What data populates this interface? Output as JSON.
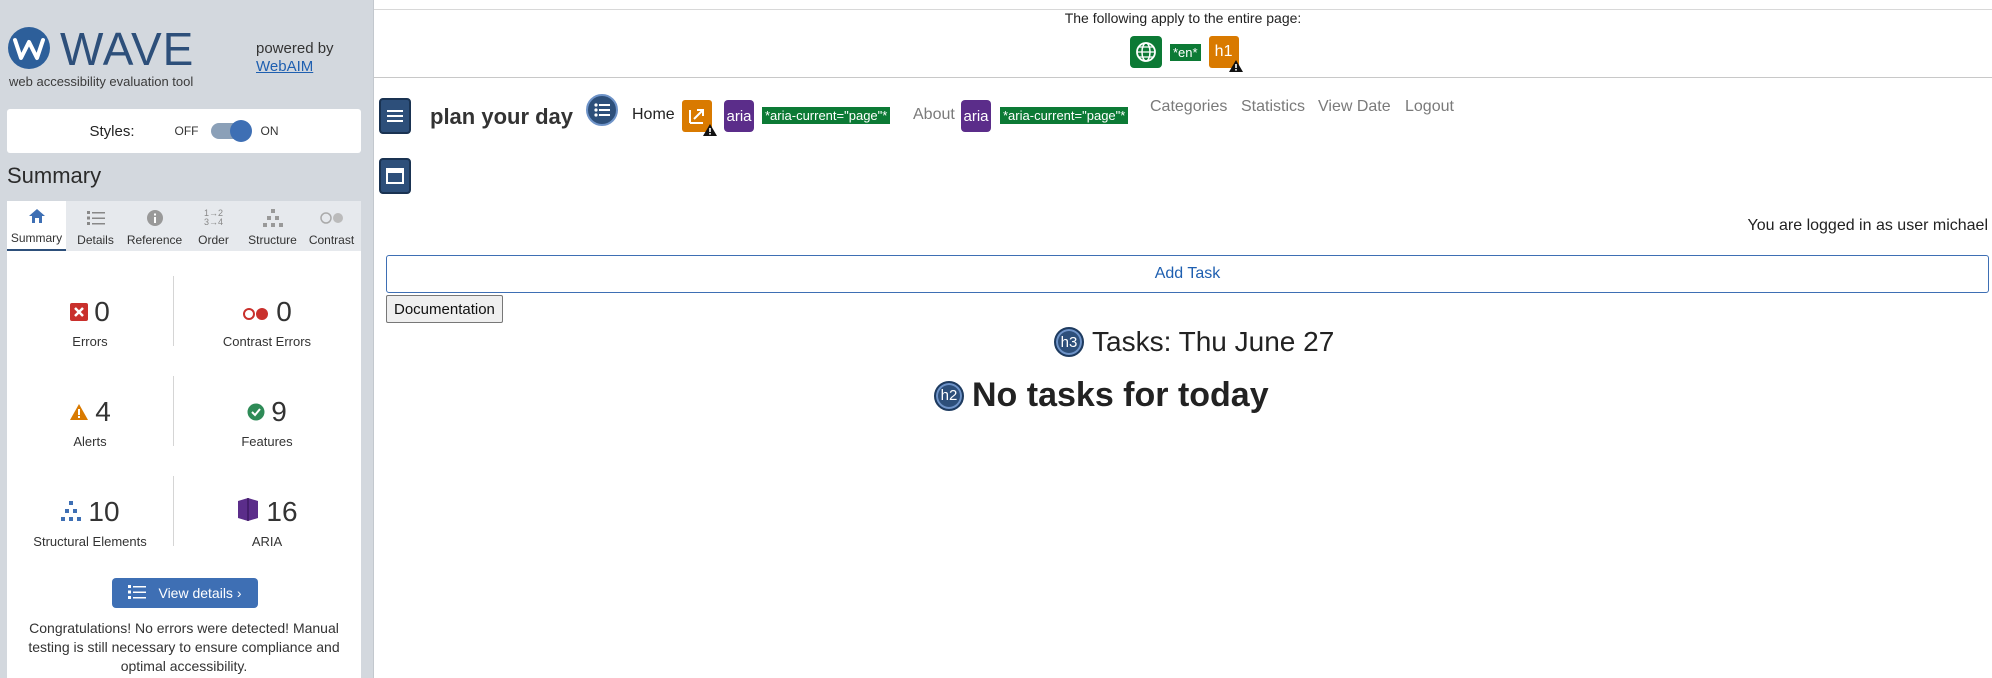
{
  "wave": {
    "logo_text": "WAVE",
    "tagline": "web accessibility evaluation tool",
    "powered_by": "powered by",
    "webaim": "WebAIM",
    "styles_label": "Styles:",
    "off": "OFF",
    "on": "ON",
    "summary_title": "Summary",
    "tabs": [
      {
        "label": "Summary",
        "icon": "home-icon"
      },
      {
        "label": "Details",
        "icon": "list-icon"
      },
      {
        "label": "Reference",
        "icon": "info-icon"
      },
      {
        "label": "Order",
        "icon": "order-icon"
      },
      {
        "label": "Structure",
        "icon": "structure-icon"
      },
      {
        "label": "Contrast",
        "icon": "contrast-icon"
      }
    ],
    "stats": {
      "errors": {
        "value": "0",
        "label": "Errors"
      },
      "contrast_errors": {
        "value": "0",
        "label": "Contrast Errors"
      },
      "alerts": {
        "value": "4",
        "label": "Alerts"
      },
      "features": {
        "value": "9",
        "label": "Features"
      },
      "structural": {
        "value": "10",
        "label": "Structural Elements"
      },
      "aria": {
        "value": "16",
        "label": "ARIA"
      }
    },
    "view_details": "View details ›",
    "congrats": "Congratulations! No errors were detected! Manual testing is still necessary to ensure compliance and optimal accessibility."
  },
  "page": {
    "apply_text": "The following apply to the entire page:",
    "lang_label": "*en*",
    "h1_label": "h1",
    "brand": "plan your day",
    "nav": {
      "home": "Home",
      "aria": "aria",
      "aria_current_1": "*aria-current=\"page\"*",
      "about": "About",
      "aria_current_2": "*aria-current=\"page\"*",
      "categories": "Categories",
      "statistics": "Statistics",
      "view_date": "View Date",
      "logout": "Logout"
    },
    "logged_in": "You are logged in as user michael",
    "add_task": "Add Task",
    "documentation": "Documentation",
    "h3_badge": "h3",
    "tasks_heading": "Tasks: Thu June 27",
    "h2_badge": "h2",
    "no_tasks": "No tasks for today"
  },
  "colors": {
    "wave_blue": "#3e6fb4",
    "wave_dark": "#2d4f7a",
    "sidebar_bg": "#d3d8de",
    "aria_purple": "#5b2d8a",
    "aria_green": "#0c7a35",
    "alert_orange": "#d97a00",
    "error_red": "#c9302c"
  }
}
